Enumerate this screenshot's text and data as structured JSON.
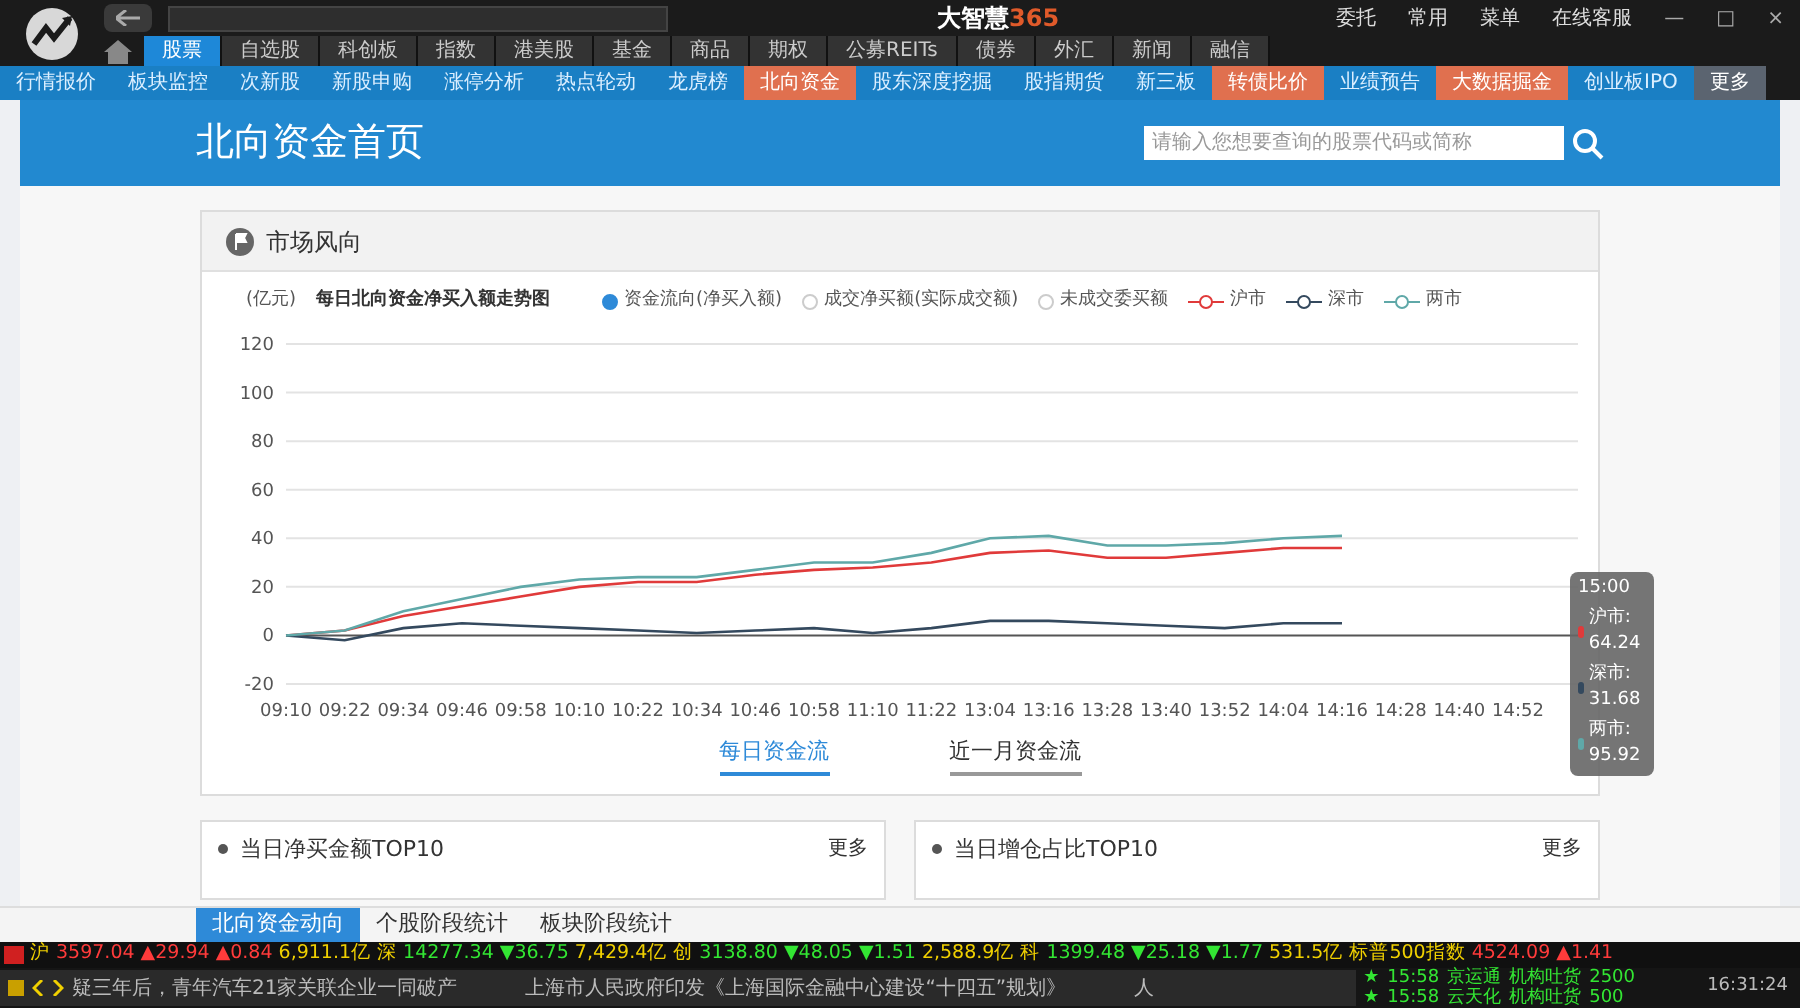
{
  "app": {
    "title": "大智慧",
    "title_suffix": "365",
    "menu": [
      "委托",
      "常用",
      "菜单",
      "在线客服"
    ],
    "window_controls": [
      {
        "kind": "minimize",
        "text": "—"
      },
      {
        "kind": "maximize",
        "text": "□"
      },
      {
        "kind": "close",
        "text": "×"
      }
    ]
  },
  "main_tabs": [
    {
      "label": "股票",
      "selected": true
    },
    {
      "label": "自选股",
      "selected": false
    },
    {
      "label": "科创板",
      "selected": false
    },
    {
      "label": "指数",
      "selected": false
    },
    {
      "label": "港美股",
      "selected": false
    },
    {
      "label": "基金",
      "selected": false
    },
    {
      "label": "商品",
      "selected": false
    },
    {
      "label": "期权",
      "selected": false
    },
    {
      "label": "公募REITs",
      "selected": false
    },
    {
      "label": "债券",
      "selected": false
    },
    {
      "label": "外汇",
      "selected": false
    },
    {
      "label": "新闻",
      "selected": false
    },
    {
      "label": "融信",
      "selected": false
    }
  ],
  "sub_nav": [
    {
      "label": "行情报价",
      "kind": "plain"
    },
    {
      "label": "板块监控",
      "kind": "plain"
    },
    {
      "label": "次新股",
      "kind": "plain"
    },
    {
      "label": "新股申购",
      "kind": "plain"
    },
    {
      "label": "涨停分析",
      "kind": "plain"
    },
    {
      "label": "热点轮动",
      "kind": "plain"
    },
    {
      "label": "龙虎榜",
      "kind": "plain"
    },
    {
      "label": "北向资金",
      "kind": "hot"
    },
    {
      "label": "股东深度挖掘",
      "kind": "plain"
    },
    {
      "label": "股指期货",
      "kind": "plain"
    },
    {
      "label": "新三板",
      "kind": "plain"
    },
    {
      "label": "转债比价",
      "kind": "hot"
    },
    {
      "label": "业绩预告",
      "kind": "plain"
    },
    {
      "label": "大数据掘金",
      "kind": "hot"
    },
    {
      "label": "创业板IPO",
      "kind": "plain"
    },
    {
      "label": "更多",
      "kind": "more"
    }
  ],
  "page": {
    "title": "北向资金首页",
    "search": {
      "placeholder": "请输入您想要查询的股票代码或简称"
    }
  },
  "market_card": {
    "title": "市场风向",
    "unit": "(亿元)",
    "chart_title": "每日北向资金净买入额走势图",
    "modes": [
      {
        "label": "资金流向(净买入额)",
        "selected": true
      },
      {
        "label": "成交净买额(实际成交额)",
        "selected": false
      },
      {
        "label": "未成交委买额",
        "selected": false
      }
    ],
    "chart_data": {
      "type": "line",
      "grid": true,
      "x": [
        "09:10",
        "09:22",
        "09:34",
        "09:46",
        "09:58",
        "10:10",
        "10:22",
        "10:34",
        "10:46",
        "10:58",
        "11:10",
        "11:22",
        "13:04",
        "13:16",
        "13:28",
        "13:40",
        "13:52",
        "14:04",
        "14:16",
        "14:28",
        "14:40",
        "14:52"
      ],
      "ylim": [
        -20,
        120
      ],
      "yticks": [
        -20,
        0,
        20,
        40,
        60,
        80,
        100,
        120
      ],
      "series": [
        {
          "name": "沪市",
          "color": "#e03a3a",
          "values": [
            0,
            2,
            8,
            12,
            16,
            20,
            22,
            22,
            25,
            27,
            28,
            30,
            34,
            35,
            32,
            32,
            34,
            36,
            36,
            null,
            null,
            null
          ]
        },
        {
          "name": "深市",
          "color": "#34495e",
          "values": [
            0,
            -2,
            3,
            5,
            4,
            3,
            2,
            1,
            2,
            3,
            1,
            3,
            6,
            6,
            5,
            4,
            3,
            5,
            5,
            null,
            null,
            null
          ]
        },
        {
          "name": "两市",
          "color": "#5fa8a8",
          "values": [
            0,
            2,
            10,
            15,
            20,
            23,
            24,
            24,
            27,
            30,
            30,
            34,
            40,
            41,
            37,
            37,
            38,
            40,
            41,
            null,
            null,
            null
          ]
        }
      ]
    },
    "tooltip": {
      "time": "15:00",
      "rows": [
        {
          "label": "沪市: 64.24",
          "color": "#e03a3a"
        },
        {
          "label": "深市: 31.68",
          "color": "#34495e"
        },
        {
          "label": "两市: 95.92",
          "color": "#5fa8a8"
        }
      ]
    },
    "tabs": [
      {
        "label": "每日资金流",
        "selected": true
      },
      {
        "label": "近一月资金流",
        "selected": false
      }
    ]
  },
  "panels": [
    {
      "title": "当日净买金额TOP10",
      "more": "更多"
    },
    {
      "title": "当日增仓占比TOP10",
      "more": "更多"
    }
  ],
  "bottom_tabs": [
    {
      "label": "北向资金动向",
      "selected": true
    },
    {
      "label": "个股阶段统计",
      "selected": false
    },
    {
      "label": "板块阶段统计",
      "selected": false
    }
  ],
  "ticker": [
    {
      "kind": "label",
      "text": "沪"
    },
    {
      "kind": "up",
      "text": "3597.04"
    },
    {
      "kind": "up",
      "text": "▲29.94"
    },
    {
      "kind": "up",
      "text": "▲0.84"
    },
    {
      "kind": "amount",
      "text": "6,911.1亿"
    },
    {
      "kind": "label",
      "text": "深"
    },
    {
      "kind": "down",
      "text": "14277.34"
    },
    {
      "kind": "down",
      "text": "▼36.75"
    },
    {
      "kind": "amount",
      "text": "7,429.4亿"
    },
    {
      "kind": "label",
      "text": "创"
    },
    {
      "kind": "down",
      "text": "3138.80"
    },
    {
      "kind": "down",
      "text": "▼48.05"
    },
    {
      "kind": "down",
      "text": "▼1.51"
    },
    {
      "kind": "amount",
      "text": "2,588.9亿"
    },
    {
      "kind": "label",
      "text": "科"
    },
    {
      "kind": "down",
      "text": "1399.48"
    },
    {
      "kind": "down",
      "text": "▼25.18"
    },
    {
      "kind": "down",
      "text": "▼1.77"
    },
    {
      "kind": "amount",
      "text": "531.5亿"
    },
    {
      "kind": "label",
      "text": "标普500指数"
    },
    {
      "kind": "up",
      "text": "4524.09"
    },
    {
      "kind": "up",
      "text": "▲1.41"
    }
  ],
  "news": [
    "疑三年后，青年汽车21家关联企业一同破产",
    "上海市人民政府印发《上海国际金融中心建设“十四五”规划》",
    "人"
  ],
  "alerts": [
    {
      "marker": "★",
      "time": "15:58",
      "stock": "京运通",
      "action": "机构吐货",
      "volume": "2500"
    },
    {
      "marker": "★",
      "time": "15:58",
      "stock": "云天化",
      "action": "机构吐货",
      "volume": "500"
    }
  ],
  "clock": "16:31:24"
}
